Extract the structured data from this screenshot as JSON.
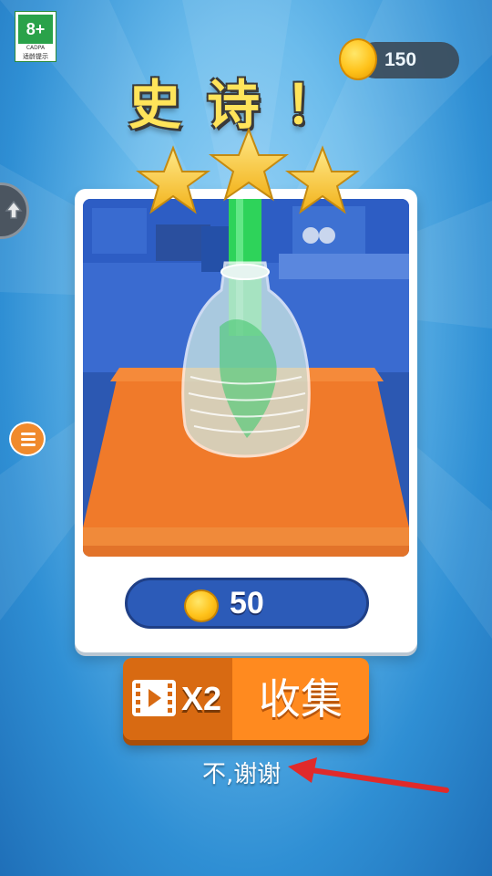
{
  "age_rating": {
    "label": "8+",
    "org": "CADPA",
    "tip": "适龄提示"
  },
  "header": {
    "coins": "150",
    "title": "史诗！"
  },
  "result": {
    "stars_earned": 3,
    "stars_total": 3,
    "reward_coins": "50"
  },
  "actions": {
    "multiplier": "X2",
    "collect_label": "收集",
    "decline_label": "不,谢谢"
  },
  "icons": {
    "coin": "coin-icon",
    "share": "share-icon",
    "menu": "list-menu-icon",
    "video": "video-ad-icon",
    "star": "star-icon",
    "arrow": "red-arrow"
  },
  "colors": {
    "accent_orange": "#ff8a1f",
    "coin_bar": "#2c5bb8",
    "title_yellow": "#ffe45a",
    "arrow_red": "#e02a2a"
  }
}
